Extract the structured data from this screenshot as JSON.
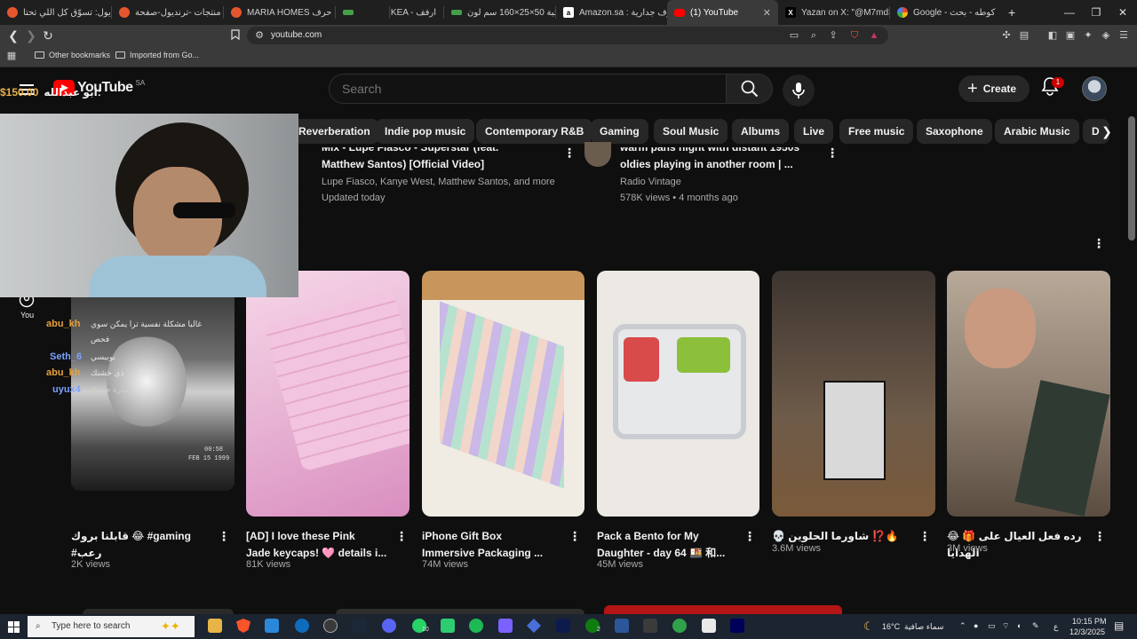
{
  "browser": {
    "tabs": [
      {
        "label": "ترنديول: تسوّق كل اللي تحتا…",
        "color": "#e4572e"
      },
      {
        "label": "كل منتجات -ترنديول-صفحة…",
        "color": "#e4572e"
      },
      {
        "label": "MARIA HOMES شكل حرف",
        "color": "#e4572e"
      },
      {
        "label": "",
        "color": "#2e7d32"
      },
      {
        "label": "IKEA - ارفف",
        "color": "#2e7d32"
      },
      {
        "label": "مكتبة 50×25×160 سم لون",
        "color": "#2e7d32"
      },
      {
        "label": "Amazon.sa : رفوف جدارية",
        "color": "#ffffff",
        "glyph": "a"
      },
      {
        "label": "(1) YouTube",
        "color": "#ff0000",
        "active": true,
        "close": "✕"
      },
      {
        "label": "Yazan on X: \"@M7md35_C",
        "color": "#000000",
        "glyph": "X"
      },
      {
        "label": "Google - كوطه - بحث",
        "color": "#4285f4"
      }
    ],
    "new_tab": "+",
    "window": {
      "minimize": "—",
      "restore": "❐",
      "close": "✕"
    },
    "nav": {
      "back": "❮",
      "forward": "❯",
      "reload": "↻"
    },
    "url": "youtube.com",
    "bookmarks": [
      "Other bookmarks",
      "Imported from Go..."
    ]
  },
  "youtube": {
    "logo_text": "YouTube",
    "logo_region": "SA",
    "search_placeholder": "Search",
    "create_label": "Create",
    "notification_count": "1",
    "chips": [
      "Reverberation",
      "Indie pop music",
      "Contemporary R&B",
      "Gaming",
      "Soul Music",
      "Albums",
      "Live",
      "Free music",
      "Saxophone",
      "Arabic Music",
      "D"
    ],
    "previous_row": [
      {
        "title_line1": "Mix - Lupe Fiasco - Superstar (feat.",
        "title_line2": "Matthew Santos) [Official Video]",
        "meta1": "Lupe Fiasco, Kanye West, Matthew Santos, and more",
        "meta2": "Updated today"
      },
      {
        "title_line1": "warm pans night with distant 1950s",
        "title_line2": "oldies playing in another room | ...",
        "meta1": "Radio Vintage",
        "meta2": "578K views • 4 months ago"
      }
    ],
    "sidebar_you": "You",
    "shorts": [
      {
        "title": "قابلنا بروك 😂 #gaming\n#رعب",
        "views": "2K views"
      },
      {
        "title": "[AD] I love these Pink\nJade keycaps! 🩷 details i...",
        "views": "81K views"
      },
      {
        "title": "iPhone Gift Box\nImmersive Packaging ...",
        "views": "74M views"
      },
      {
        "title": "Pack a  Bento for My\nDaughter - day 64 🍱 和...",
        "views": "45M views"
      },
      {
        "title": "💀 شاورما الحلوين ⁉️🔥",
        "views": "3.6M views"
      },
      {
        "title": "😂 🎁 رده فعل العيال على الهدايا",
        "views": "3M views"
      }
    ]
  },
  "stream_overlay": {
    "donation_name": "ابو عبدالله:",
    "donation_amount": "$150.00",
    "chat": [
      {
        "name": "abu_kh",
        "color": "#e6a23c",
        "text": "غالبا مشكلة نفسية ترا يمكن سوي"
      },
      {
        "name": "",
        "color": "#ffffff",
        "text": "فحص"
      },
      {
        "name": "Seth_6",
        "color": "#7aa2ff",
        "text": "بوبيسي"
      },
      {
        "name": "abu_kh",
        "color": "#e6a23c",
        "text": "ذي خشتك"
      },
      {
        "name": "uyux4",
        "color": "#7aa2ff",
        "text": "سيارة حمراء"
      }
    ],
    "thumb_timestamp": "00:58",
    "thumb_date": "FEB 15 1999"
  },
  "taskbar": {
    "search_placeholder": "Type here to search",
    "badge_whatsapp": "10",
    "badge_xbox": "2",
    "weather_temp": "16°C",
    "weather_text": "سماء صافية",
    "lang": "ع",
    "time": "10:15 PM",
    "date": "12/3/2025"
  }
}
